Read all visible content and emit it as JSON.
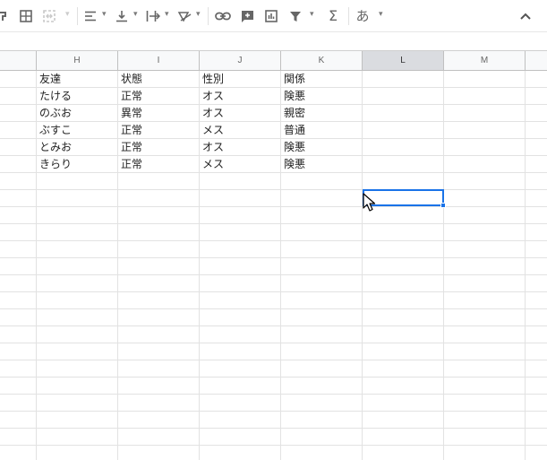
{
  "toolbar": {
    "items": [
      {
        "name": "paint-format-icon"
      },
      {
        "name": "borders-icon"
      },
      {
        "name": "merge-cells-icon",
        "disabled": true
      },
      {
        "name": "horizontal-align-icon"
      },
      {
        "name": "vertical-align-icon"
      },
      {
        "name": "text-wrapping-icon"
      },
      {
        "name": "text-rotation-icon"
      },
      {
        "name": "insert-link-icon"
      },
      {
        "name": "insert-comment-icon"
      },
      {
        "name": "insert-chart-icon"
      },
      {
        "name": "filter-icon"
      },
      {
        "name": "functions-icon",
        "glyph": "Σ"
      },
      {
        "name": "input-tools-icon",
        "glyph": "あ"
      },
      {
        "name": "collapse-toolbar-icon"
      }
    ]
  },
  "columns": [
    "H",
    "I",
    "J",
    "K",
    "L",
    "M"
  ],
  "selected_column": "L",
  "table": {
    "header": [
      "友達",
      "状態",
      "性別",
      "関係"
    ],
    "rows": [
      [
        "たける",
        "正常",
        "オス",
        "険悪"
      ],
      [
        "のぶお",
        "異常",
        "オス",
        "親密"
      ],
      [
        "ぶすこ",
        "正常",
        "メス",
        "普通"
      ],
      [
        "とみお",
        "正常",
        "オス",
        "険悪"
      ],
      [
        "きらり",
        "正常",
        "メス",
        "険悪"
      ]
    ]
  },
  "colors": {
    "selection": "#1a73e8",
    "header_bg": "#f8f9fa",
    "selected_header_bg": "#dadce0",
    "gridline": "#e2e2e2"
  }
}
